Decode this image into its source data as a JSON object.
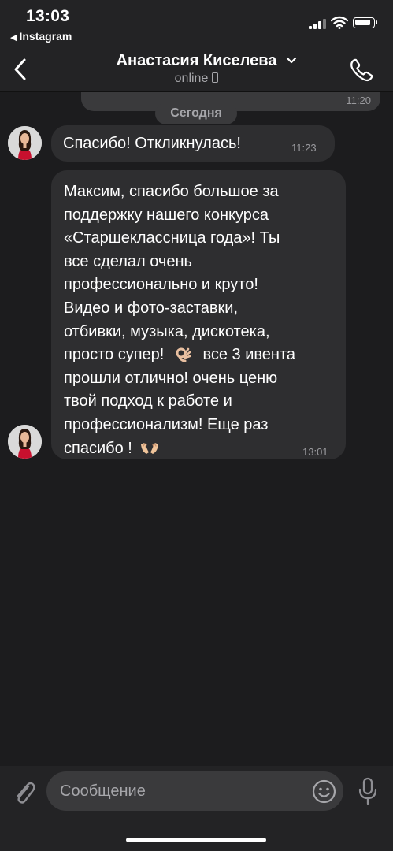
{
  "status_bar": {
    "time": "13:03",
    "back_app": "Instagram"
  },
  "header": {
    "contact_name": "Анастасия Киселева",
    "presence": "online",
    "icons": [
      "back-chevron-icon",
      "chevron-down-icon",
      "phone-icon",
      "call-icon"
    ]
  },
  "chat": {
    "previous_time": "11:20",
    "date_label": "Сегодня",
    "messages": [
      {
        "text": "Спасибо! Откликнулась!",
        "time": "11:23"
      },
      {
        "lines": [
          "Максим, спасибо большое за",
          "поддержку нашего конкурса",
          "«Старшеклассница года»!  Ты",
          "все сделал очень",
          "профессионально и круто!",
          "Видео и фото-заставки,",
          "отбивки, музыка, дискотека,",
          "просто супер!",
          "все 3 ивента",
          "прошли отлично! очень ценю",
          "твой подход к работе и",
          "профессионализм! Еще раз",
          "спасибо !"
        ],
        "emojis": [
          "ok-hand-emoji",
          "open-hands-emoji"
        ],
        "time": "13:01"
      }
    ]
  },
  "composer": {
    "placeholder": "Сообщение",
    "icons": [
      "paperclip-icon",
      "smiley-icon",
      "microphone-icon"
    ]
  },
  "colors": {
    "background": "#1c1c1e",
    "bar": "#232325",
    "bubble": "#2e2e30",
    "secondary_text": "#a6a6aa"
  }
}
